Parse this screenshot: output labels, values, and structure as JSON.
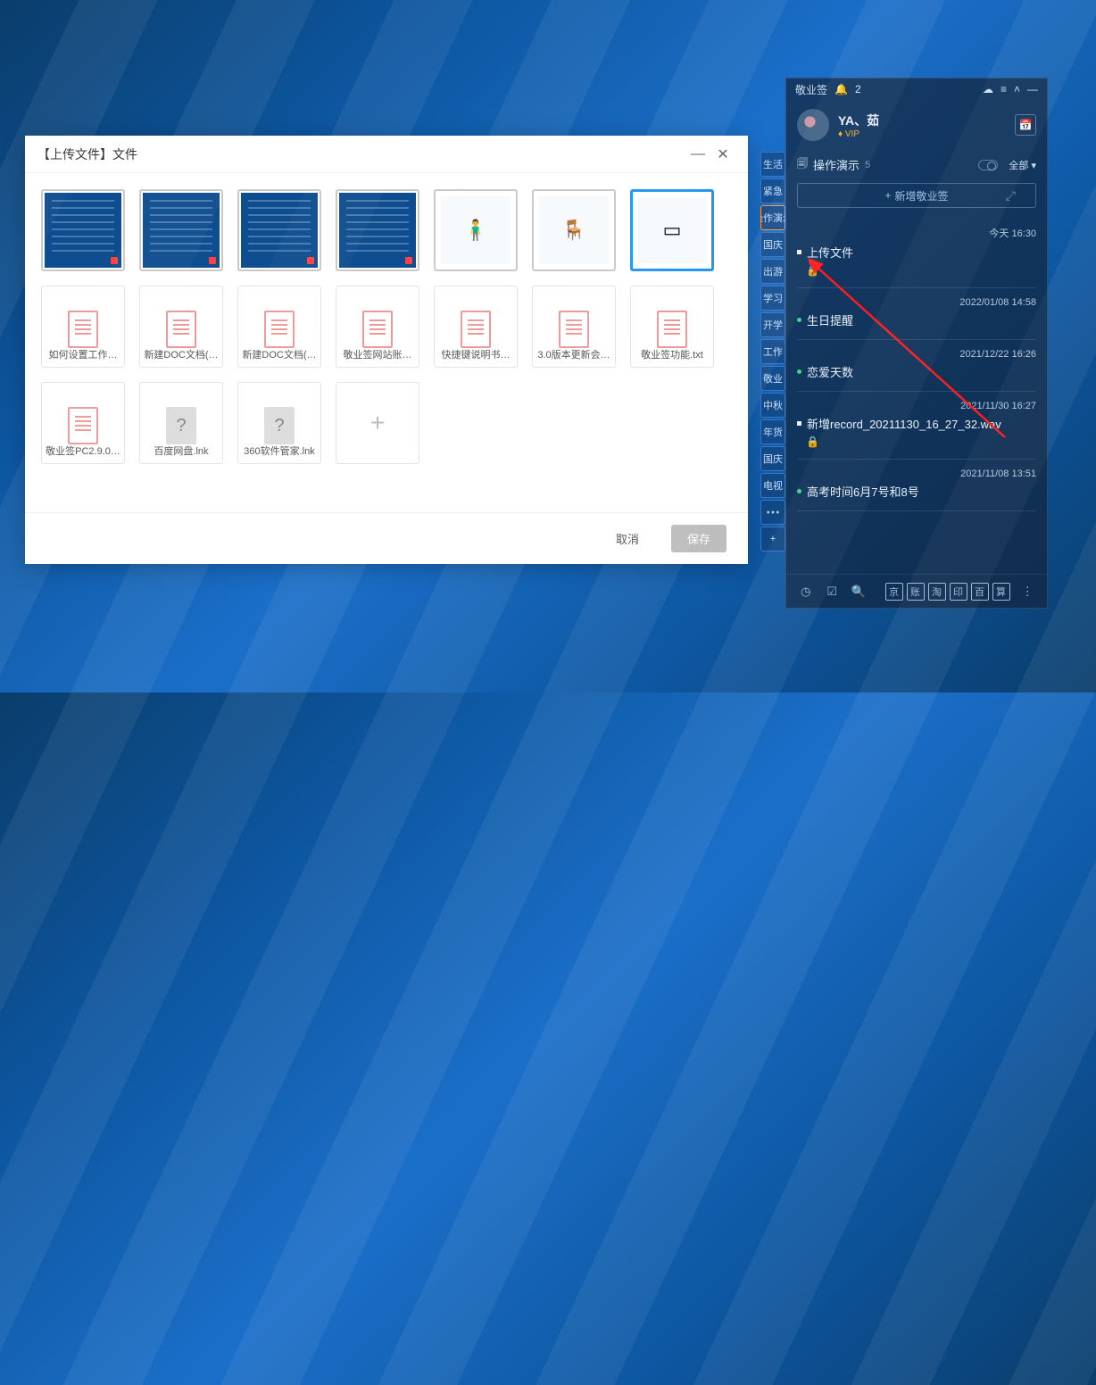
{
  "dialog": {
    "title": "【上传文件】文件",
    "tiles_img": [
      {
        "kind": "dark"
      },
      {
        "kind": "dark"
      },
      {
        "kind": "cal"
      },
      {
        "kind": "cal"
      },
      {
        "kind": "illus",
        "glyph": "🧍‍♂️"
      },
      {
        "kind": "illus",
        "glyph": "🪑"
      },
      {
        "kind": "illus",
        "glyph": "▭",
        "selected": true
      }
    ],
    "tiles_doc": [
      {
        "label": "如何设置工作…",
        "icon": "doc"
      },
      {
        "label": "新建DOC文档(…",
        "icon": "doc"
      },
      {
        "label": "新建DOC文档(…",
        "icon": "doc"
      },
      {
        "label": "敬业签网站账…",
        "icon": "doc"
      },
      {
        "label": "快捷键说明书…",
        "icon": "doc"
      },
      {
        "label": "3.0版本更新会…",
        "icon": "doc"
      },
      {
        "label": "敬业签功能.txt",
        "icon": "doc"
      },
      {
        "label": "敬业签PC2.9.0…",
        "icon": "doc"
      },
      {
        "label": "百度网盘.lnk",
        "icon": "q"
      },
      {
        "label": "360软件管家.lnk",
        "icon": "q"
      }
    ],
    "cancel": "取消",
    "save": "保存"
  },
  "tags": [
    "生活",
    "紧急",
    "操作演示",
    "国庆",
    "出游",
    "学习",
    "开学",
    "工作",
    "敬业",
    "中秋",
    "年货",
    "国庆",
    "电视"
  ],
  "tag_selected_index": 2,
  "panel": {
    "app": "敬业签",
    "notif_count": "2",
    "user": "YA、茹",
    "vip": "VIP",
    "section": "操作演示",
    "section_count": "5",
    "filter": "全部",
    "add_label": "新增敬业签",
    "items": [
      {
        "ts": "今天 16:30",
        "dot": "wh",
        "title": "上传文件",
        "lock": true
      },
      {
        "ts": "2022/01/08 14:58",
        "dot": "gr",
        "title": "生日提醒"
      },
      {
        "ts": "2021/12/22 16:26",
        "dot": "gr",
        "title": "恋爱天数"
      },
      {
        "ts": "2021/11/30 16:27",
        "dot": "wh",
        "title": "新增record_20211130_16_27_32.wav",
        "lock": true
      },
      {
        "ts": "2021/11/08 13:51",
        "dot": "gr",
        "title": "高考时间6月7号和8号"
      }
    ],
    "foot_sq": [
      "京",
      "账",
      "淘",
      "印",
      "百",
      "算"
    ]
  }
}
